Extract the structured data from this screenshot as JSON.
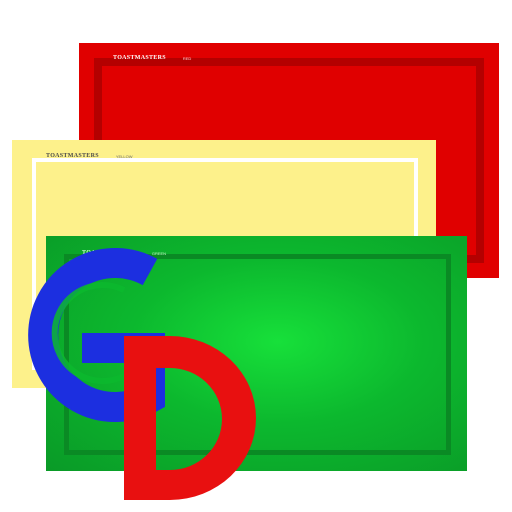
{
  "cards": [
    {
      "id": "red",
      "brand": "TOASTMASTERS",
      "tag": "RED",
      "color": "#e00000"
    },
    {
      "id": "yellow",
      "brand": "TOASTMASTERS",
      "tag": "YELLOW",
      "color": "#fdf18b"
    },
    {
      "id": "green",
      "brand": "TOASTMASTERS",
      "tag": "GREEN",
      "color": "#0cb82e"
    }
  ],
  "logo": {
    "letters": [
      "G",
      "D"
    ],
    "colors": {
      "G": "#1c2fe0",
      "D": "#e81010",
      "G_inner": "#0cb82e"
    }
  }
}
